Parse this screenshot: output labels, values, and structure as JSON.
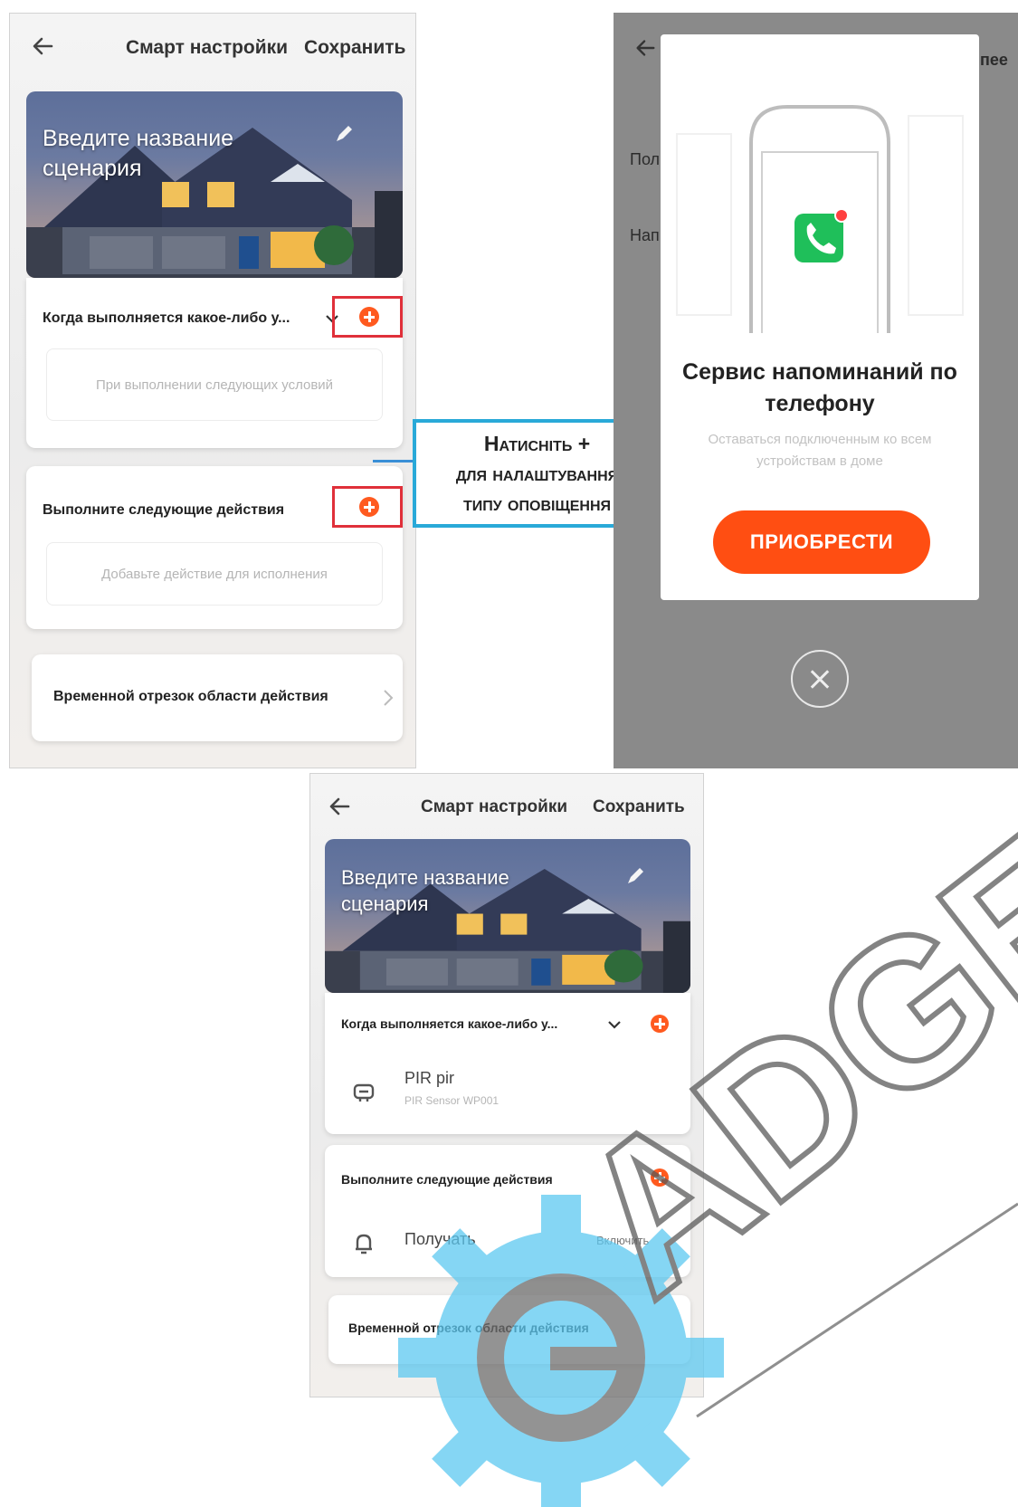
{
  "screen_left": {
    "back_icon": "arrow-left-icon",
    "title": "Смарт настройки",
    "save_label": "Сохранить",
    "hero_title": "Введите название сценария",
    "edit_icon": "pencil-icon",
    "condition_card": {
      "title": "Когда выполняется какое-либо у...",
      "placeholder": "При выполнении следующих условий"
    },
    "action_card": {
      "title": "Выполните следующие действия",
      "placeholder": "Добавьте действие для исполнения"
    },
    "time_card": {
      "title": "Временной отрезок области действия"
    }
  },
  "callout": {
    "text": "Натисніть +\nдля налаштування\nтипу оповіщення"
  },
  "screen_right": {
    "background_labels": [
      "Пол",
      "Нап"
    ],
    "background_title_fragment": "пее",
    "dialog": {
      "title": "Сервис напоминаний по телефону",
      "subtitle": "Оставаться подключенным ко всем устройствам в доме",
      "buy_label": "ПРИОБРЕСТИ",
      "phone_icon": "phone-call-icon"
    },
    "close_icon": "close-icon"
  },
  "screen_bottom": {
    "title": "Смарт настройки",
    "save_label": "Сохранить",
    "hero_title": "Введите название сценария",
    "condition_card": {
      "title": "Когда выполняется какое-либо у...",
      "device_name": "PIR pir",
      "device_sub": "PIR Sensor WP001",
      "device_icon": "sensor-icon"
    },
    "action_card": {
      "title": "Выполните следующие действия",
      "action_label": "Получать",
      "action_value": "Включить",
      "action_icon": "bell-icon"
    },
    "time_card": {
      "title": "Временной отрезок области действия"
    }
  },
  "watermark": {
    "brand_text": "ADGE"
  },
  "colors": {
    "accent": "#ff5a1f",
    "highlight": "#e0303a",
    "callout_border": "#29a9d8",
    "dialog_overlay": "#8a8a8a"
  }
}
